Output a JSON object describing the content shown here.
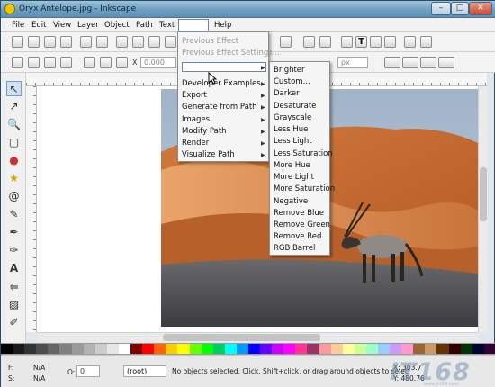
{
  "window": {
    "title": "Oryx Antelope.jpg - Inkscape",
    "controls": [
      "–",
      "□",
      "✕"
    ]
  },
  "menubar": {
    "items": [
      "File",
      "Edit",
      "View",
      "Layer",
      "Object",
      "Path",
      "Text",
      "Help"
    ]
  },
  "tool_controls": {
    "x_value": "0.000",
    "unit": "px"
  },
  "effects_menu": {
    "previous_effect": "Previous Effect",
    "previous_effect_settings": "Previous Effect Settings...",
    "items": [
      "Developer Examples",
      "Export",
      "Generate from Path",
      "Images",
      "Modify Path",
      "Render",
      "Visualize Path"
    ]
  },
  "color_submenu": {
    "items": [
      "Brighter",
      "Custom...",
      "Darker",
      "Desaturate",
      "Grayscale",
      "Less Hue",
      "Less Light",
      "Less Saturation",
      "More Hue",
      "More Light",
      "More Saturation",
      "Negative",
      "Remove Blue",
      "Remove Green",
      "Remove Red",
      "RGB Barrel"
    ]
  },
  "statusbar": {
    "fill_label": "F:",
    "fill_value": "N/A",
    "stroke_label": "S:",
    "stroke_value": "N/A",
    "opacity_label": "O:",
    "opacity_value": "0",
    "layer": "(root)",
    "message": "No objects selected. Click, Shift+click, or drag around objects to selec",
    "coord_x": "X: 303.7",
    "coord_y": "Y: 480.76"
  },
  "watermark": {
    "brand": "IT168",
    "url": "www.it168.com"
  },
  "colors": {
    "accent": "#6f9fc0",
    "menu_bg": "#f5f5f5",
    "palette": [
      "#000000",
      "#1a1a1a",
      "#333333",
      "#4d4d4d",
      "#666666",
      "#808080",
      "#999999",
      "#b3b3b3",
      "#cccccc",
      "#e6e6e6",
      "#ffffff",
      "#800000",
      "#ff0000",
      "#ff6600",
      "#ffcc00",
      "#ffff00",
      "#66ff00",
      "#00ff00",
      "#00cc66",
      "#00ffff",
      "#0099ff",
      "#0000ff",
      "#6600ff",
      "#cc00ff",
      "#ff00ff",
      "#ff3399",
      "#993366",
      "#ff9999",
      "#ffcc99",
      "#ffff99",
      "#ccff99",
      "#99ffcc",
      "#99ccff",
      "#cc99ff",
      "#ff99cc",
      "#996633",
      "#cc9966",
      "#663300",
      "#330000",
      "#003300",
      "#000033",
      "#330033"
    ]
  }
}
